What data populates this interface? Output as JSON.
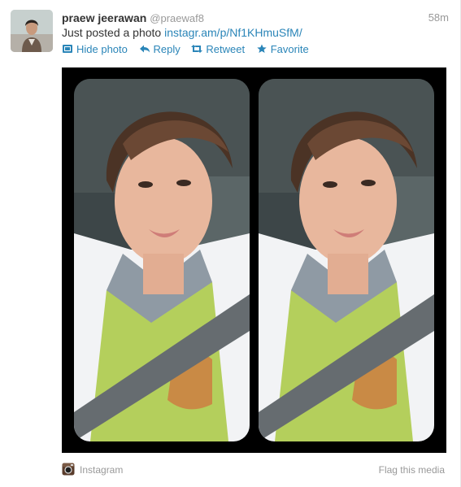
{
  "tweet": {
    "fullname": "praew jeerawan",
    "username": "@praewaf8",
    "time": "58m",
    "text_prefix": "Just posted a photo",
    "link": "instagr.am/p/Nf1KHmuSfM/"
  },
  "actions": {
    "hide_photo": "Hide photo",
    "reply": "Reply",
    "retweet": "Retweet",
    "favorite": "Favorite"
  },
  "media": {
    "source": "Instagram",
    "flag": "Flag this media"
  },
  "colors": {
    "link": "#2a85b8",
    "muted": "#999999",
    "text": "#333333",
    "media_bg": "#000000"
  },
  "icons": [
    "hide-photo-icon",
    "reply-icon",
    "retweet-icon",
    "favorite-icon",
    "instagram-icon"
  ]
}
